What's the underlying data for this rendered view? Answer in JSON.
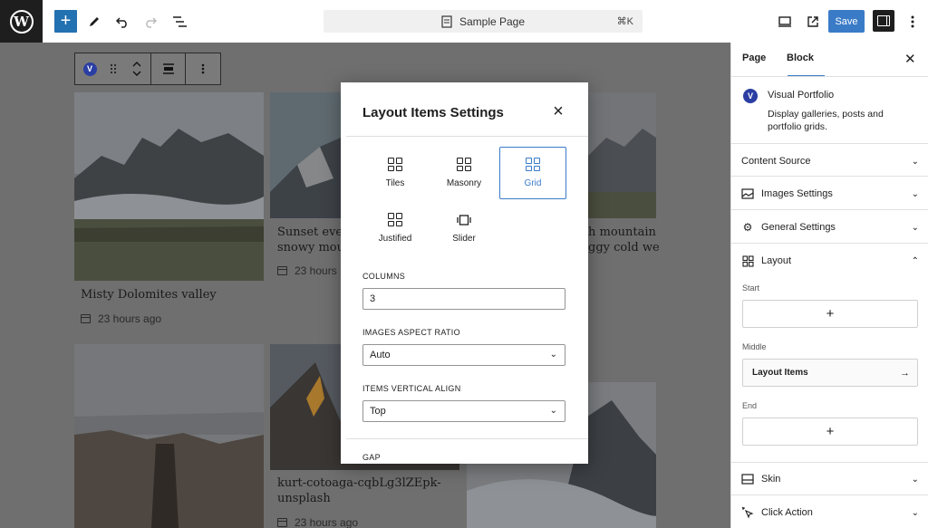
{
  "topbar": {
    "logo_letter": "W",
    "document_title": "Sample Page",
    "shortcut": "⌘K",
    "save_label": "Save"
  },
  "canvas": {
    "cards": [
      {
        "title": "Misty Dolomites valley",
        "meta": "23 hours ago"
      },
      {
        "title_lines": [
          "Sunset eveni",
          "snowy moun"
        ],
        "meta": "23 hours"
      },
      {
        "title_lines": [
          "h mountain",
          "ggy cold we"
        ]
      },
      {
        "title_lines": [
          "kurt-cotoaga-cqbLg3lZEpk-",
          "unsplash"
        ],
        "meta": "23 hours ago"
      }
    ],
    "block_icon_letter": "V"
  },
  "modal": {
    "title": "Layout Items Settings",
    "layouts": [
      {
        "label": "Tiles",
        "selected": false
      },
      {
        "label": "Masonry",
        "selected": false
      },
      {
        "label": "Grid",
        "selected": true
      },
      {
        "label": "Justified",
        "selected": false
      },
      {
        "label": "Slider",
        "selected": false
      }
    ],
    "columns_label": "COLUMNS",
    "columns_value": "3",
    "aspect_label": "IMAGES ASPECT RATIO",
    "aspect_value": "Auto",
    "valign_label": "ITEMS VERTICAL ALIGN",
    "valign_value": "Top",
    "gap_label": "GAP"
  },
  "sidebar": {
    "tabs": [
      "Page",
      "Block"
    ],
    "active_tab": "Block",
    "block_icon_letter": "V",
    "block_name": "Visual Portfolio",
    "block_desc_lines": [
      "Display galleries, posts and",
      "portfolio grids."
    ],
    "sections": {
      "content_source": "Content Source",
      "images_settings": "Images Settings",
      "general_settings": "General Settings",
      "layout": "Layout",
      "skin": "Skin",
      "click_action": "Click Action"
    },
    "layout_start": "Start",
    "layout_middle": "Middle",
    "layout_items": "Layout Items",
    "layout_end": "End"
  },
  "colors": {
    "accent": "#3a7bc8",
    "dark": "#1e1e1e",
    "overlay": "#6f6f6f"
  }
}
